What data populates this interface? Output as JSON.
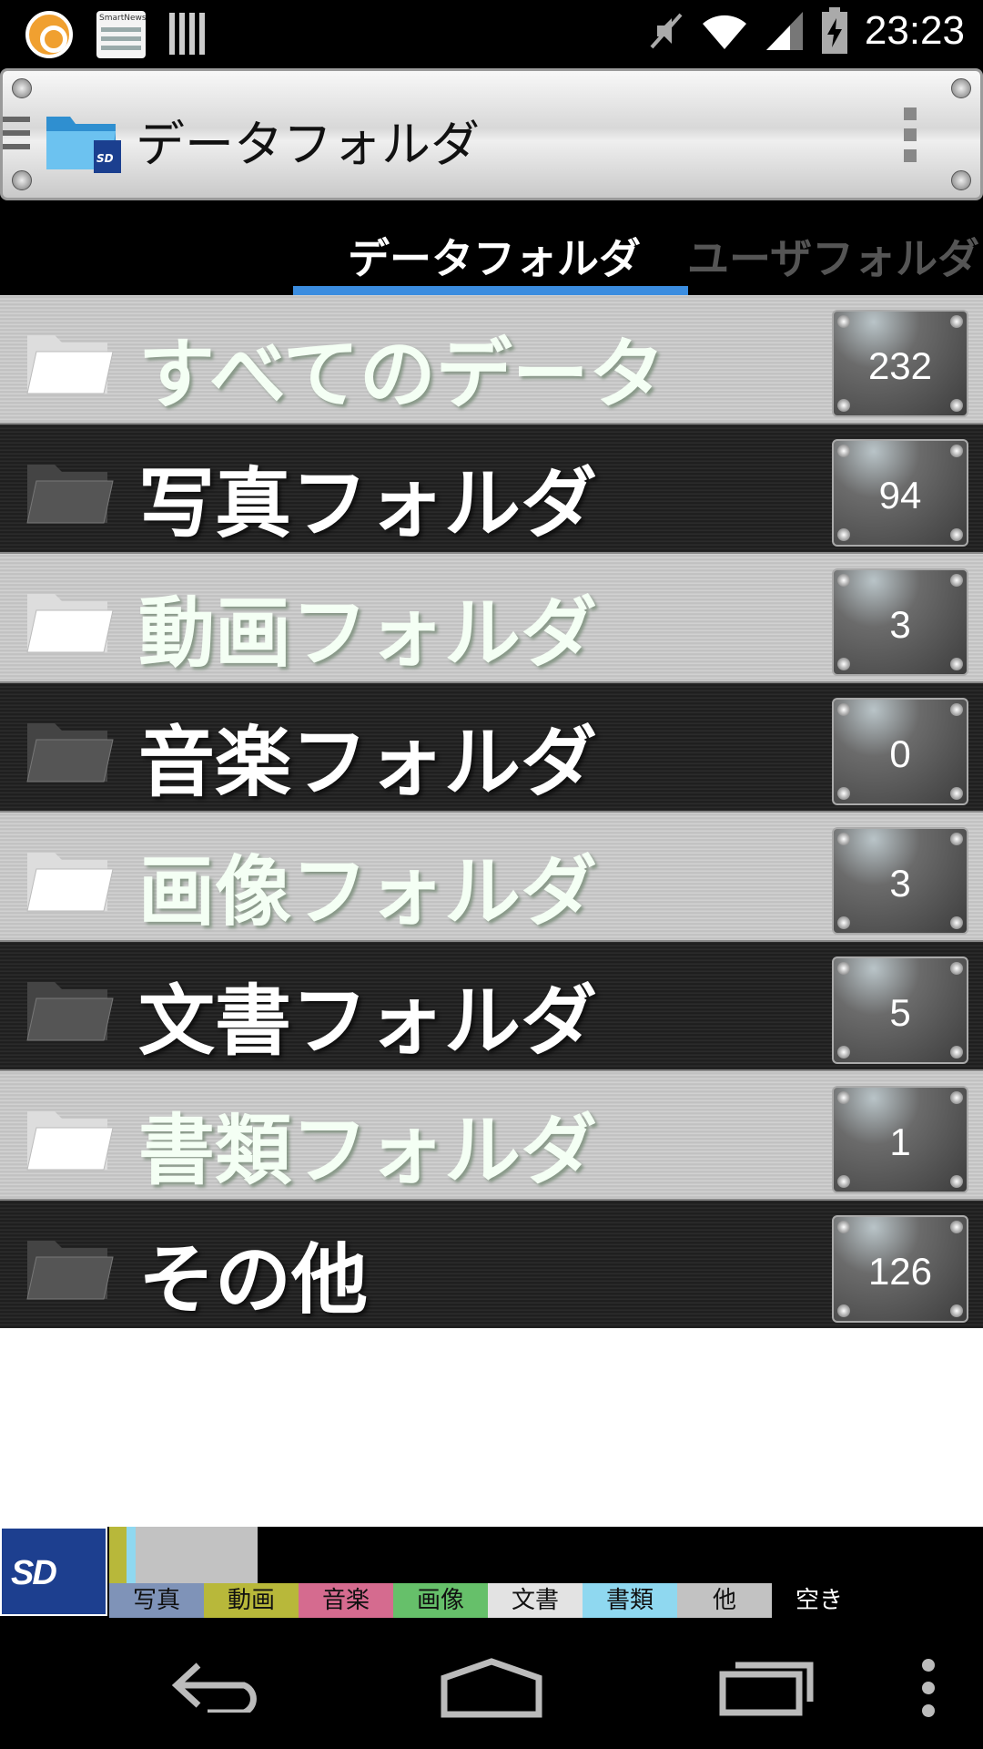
{
  "status_bar": {
    "time": "23:23",
    "left_icons": [
      "app-notification-icon",
      "smartnews-icon",
      "barcode-icon"
    ],
    "smartnews_label": "SmartNews",
    "right_icons": [
      "mute-icon",
      "wifi-icon",
      "signal-icon",
      "battery-charging-icon"
    ]
  },
  "action_bar": {
    "title": "データフォルダ"
  },
  "tabs": [
    {
      "label": "データフォルダ",
      "active": true
    },
    {
      "label": "ユーザフォルダ",
      "active": false
    }
  ],
  "folders": [
    {
      "label": "すべてのデータ",
      "count": "232"
    },
    {
      "label": "写真フォルダ",
      "count": "94"
    },
    {
      "label": "動画フォルダ",
      "count": "3"
    },
    {
      "label": "音楽フォルダ",
      "count": "0"
    },
    {
      "label": "画像フォルダ",
      "count": "3"
    },
    {
      "label": "文書フォルダ",
      "count": "5"
    },
    {
      "label": "書類フォルダ",
      "count": "1"
    },
    {
      "label": "その他",
      "count": "126"
    }
  ],
  "storage": {
    "badge": "SD",
    "legend": [
      {
        "label": "写真",
        "color": "#7f93b8"
      },
      {
        "label": "動画",
        "color": "#b8b83a"
      },
      {
        "label": "音楽",
        "color": "#d56b8f"
      },
      {
        "label": "画像",
        "color": "#66c06a"
      },
      {
        "label": "文書",
        "color": "#e3e3e3"
      },
      {
        "label": "書類",
        "color": "#8fd8f0"
      },
      {
        "label": "他",
        "color": "#c2c2c2"
      },
      {
        "label": "空き",
        "color": "#000000"
      }
    ],
    "usage_fractions": [
      {
        "category": "動画",
        "fraction": 0.02
      },
      {
        "category": "書類",
        "fraction": 0.01
      },
      {
        "category": "他",
        "fraction": 0.14
      }
    ]
  },
  "nav_bar": {
    "icons": [
      "back-icon",
      "home-icon",
      "recents-icon",
      "menu-icon"
    ]
  }
}
